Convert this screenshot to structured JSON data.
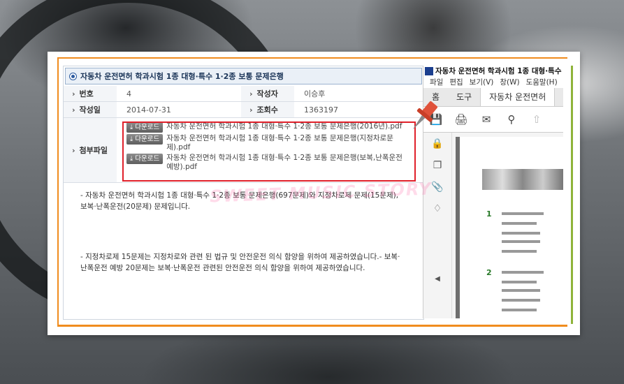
{
  "board": {
    "title": "자동차 운전면허 학과시험 1종 대형·특수 1·2종 보통 문제은행",
    "fields": {
      "no_label": "번호",
      "no_value": "4",
      "author_label": "작성자",
      "author_value": "이승후",
      "date_label": "작성일",
      "date_value": "2014-07-31",
      "views_label": "조회수",
      "views_value": "1363197",
      "attach_label": "첨부파일"
    },
    "attachments": [
      {
        "button": "다운로드",
        "name": "자동차 운전면허 학과시험 1종 대형·특수 1·2종 보통 문제은행(2016년).pdf"
      },
      {
        "button": "다운로드",
        "name": "자동차 운전면허 학과시험 1종 대형·특수 1·2종 보통 문제은행(지정차로문제).pdf"
      },
      {
        "button": "다운로드",
        "name": "자동차 운전면허 학과시험 1종 대형·특수 1·2종 보통 문제은행(보복,난폭운전예방).pdf"
      }
    ],
    "content": [
      "- 자동차 운전면허 학과시험 1종 대형·특수 1·2종 보통 문제은행(697문제)와 지정차로제 문제(15문제), 보복·난폭운전(20문제) 문제입니다.",
      "- 지정차로제 15문제는 지정차로와 관련 된 법규 및 안전운전 의식 함양을 위하여 제공하였습니다.- 보복·난폭운전 예방 20문제는 보복·난폭운전 관련된 안전운전 의식 함양을 위하여 제공하였습니다."
    ]
  },
  "pdf_viewer": {
    "title": "자동차 운전면허 학과시험 1종 대형·특수",
    "menu": [
      "파일",
      "편집",
      "보기(V)",
      "창(W)",
      "도움말(H)"
    ],
    "tabs": [
      "홈",
      "도구",
      "자동차 운전면허"
    ],
    "questions": [
      "1",
      "2"
    ]
  },
  "watermark": "SWEET MUSIC STORY"
}
